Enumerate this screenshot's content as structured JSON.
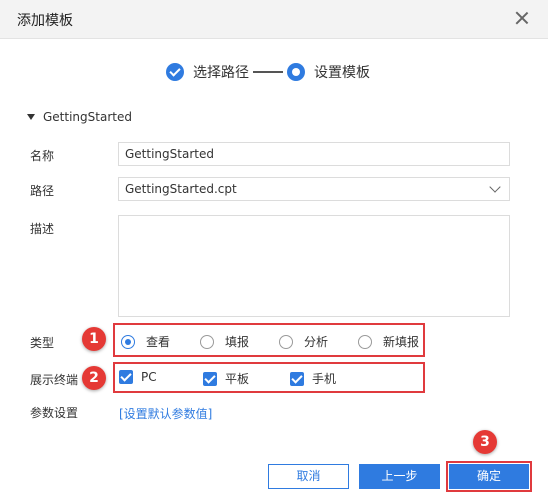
{
  "dialog": {
    "title": "添加模板"
  },
  "steps": [
    {
      "label": "选择路径",
      "state": "done"
    },
    {
      "label": "设置模板",
      "state": "current"
    }
  ],
  "group": {
    "name": "GettingStarted"
  },
  "form": {
    "name_label": "名称",
    "name_value": "GettingStarted",
    "path_label": "路径",
    "path_value": "GettingStarted.cpt",
    "desc_label": "描述",
    "desc_value": "",
    "type_label": "类型",
    "type_options": [
      "查看",
      "填报",
      "分析",
      "新填报"
    ],
    "type_selected": "查看",
    "terminal_label": "展示终端",
    "terminals": [
      "PC",
      "平板",
      "手机"
    ],
    "params_label": "参数设置",
    "params_link": "[设置默认参数值]"
  },
  "annotations": [
    "1",
    "2",
    "3"
  ],
  "buttons": {
    "cancel": "取消",
    "prev": "上一步",
    "ok": "确定"
  },
  "colors": {
    "accent": "#2f7be0",
    "highlight": "#e03a3e"
  }
}
